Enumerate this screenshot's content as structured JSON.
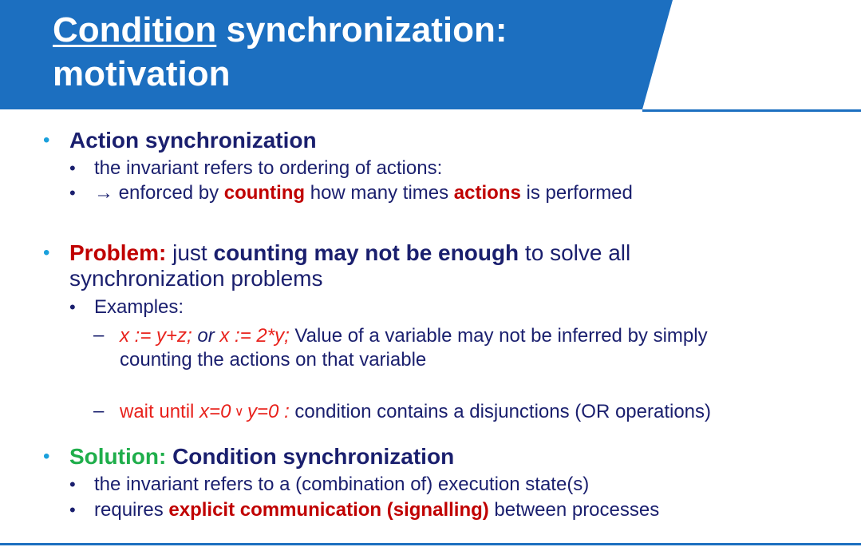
{
  "title": {
    "underlined": "Condition",
    "rest_line1": " synchronization:",
    "line2": "motivation"
  },
  "section1": {
    "heading": "Action synchronization",
    "item1": "the invariant refers to ordering of actions:",
    "item2_arrow": "→",
    "item2_a": " enforced by ",
    "item2_b": "counting",
    "item2_c": " how many times ",
    "item2_d": "actions",
    "item2_e": " is performed"
  },
  "section2": {
    "label": "Problem:",
    "text_a": " just ",
    "text_b": "counting may not be enough",
    "text_c": " to solve all",
    "text_line2": "synchronization problems",
    "examples_label": "Examples:",
    "ex1_code1": "x := y+z;",
    "ex1_or": " or ",
    "ex1_code2": "x := 2*y;",
    "ex1_text": " Value of a variable may not be inferred by simply",
    "ex1_line2": "counting the actions on that variable",
    "ex2_wait": "wait until ",
    "ex2_x": "x=0",
    "ex2_or": " ∨ ",
    "ex2_y": "y=0 :",
    "ex2_text": " condition contains a disjunctions (OR operations)"
  },
  "section3": {
    "label": "Solution:",
    "heading": " Condition synchronization",
    "item1": "the invariant refers to a (combination of) execution state(s)",
    "item2_a": "requires ",
    "item2_b": "explicit communication (signalling)",
    "item2_c": " between processes"
  },
  "bullets": {
    "main": "•",
    "sub": "•",
    "dash": "–"
  },
  "colors": {
    "header_blue": "#1c6fc0",
    "navy_text": "#1a1f6e",
    "red_emphasis": "#c00000",
    "bright_red": "#e8221c",
    "green": "#1fae4b",
    "bullet_cyan": "#1aa0dc"
  }
}
